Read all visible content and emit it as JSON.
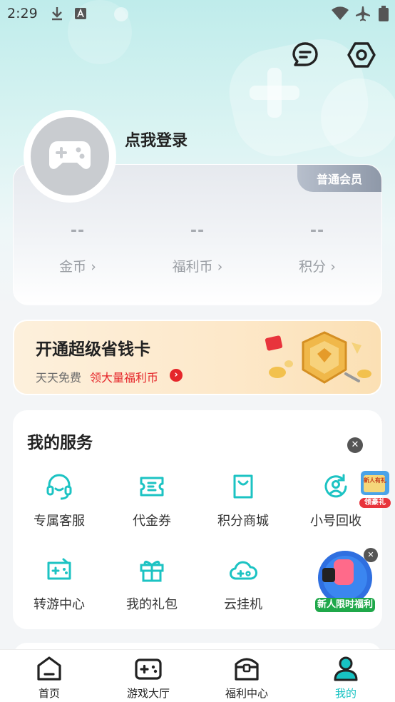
{
  "status_bar": {
    "time": "2:29"
  },
  "profile": {
    "login_prompt": "点我登录",
    "member_level": "普通会员"
  },
  "stats": [
    {
      "value": "--",
      "label": "金币 ›"
    },
    {
      "value": "--",
      "label": "福利币 ›"
    },
    {
      "value": "--",
      "label": "积分 ›"
    }
  ],
  "promo": {
    "title": "开通超级省钱卡",
    "subtitle": "天天免费",
    "highlight": "领大量福利币",
    "arrow": "›"
  },
  "services": {
    "title": "我的服务",
    "items": [
      {
        "label": "专属客服",
        "icon": "headset-icon"
      },
      {
        "label": "代金券",
        "icon": "coupon-icon"
      },
      {
        "label": "积分商城",
        "icon": "shopping-bag-icon"
      },
      {
        "label": "小号回收",
        "icon": "recycle-account-icon"
      },
      {
        "label": "转游中心",
        "icon": "transfer-game-icon"
      },
      {
        "label": "我的礼包",
        "icon": "gift-icon"
      },
      {
        "label": "云挂机",
        "icon": "cloud-gamepad-icon"
      }
    ],
    "badge_small": "领豪礼",
    "badge_small_top": "新人有礼",
    "badge_big": "新人限时福利",
    "close": "✕"
  },
  "nav": [
    {
      "label": "首页",
      "icon": "home-icon"
    },
    {
      "label": "游戏大厅",
      "icon": "gamepad-icon"
    },
    {
      "label": "福利中心",
      "icon": "treasure-chest-icon"
    },
    {
      "label": "我的",
      "icon": "user-icon"
    }
  ],
  "colors": {
    "accent": "#17c2c2",
    "red": "#e5262a"
  }
}
